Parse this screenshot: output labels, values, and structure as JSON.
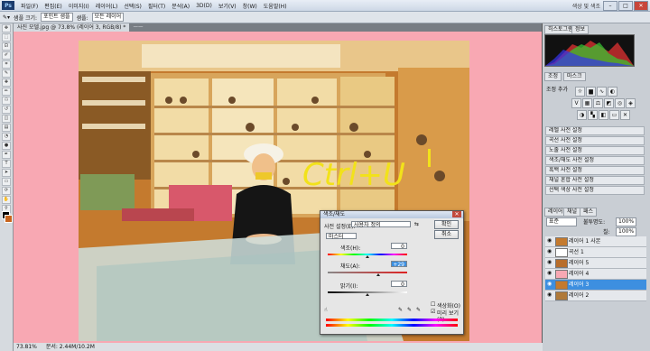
{
  "menubar": {
    "logo": "Ps",
    "items": [
      "파일(F)",
      "편집(E)",
      "이미지(I)",
      "레이어(L)",
      "선택(S)",
      "필터(T)",
      "분석(A)",
      "3D(D)",
      "보기(V)",
      "창(W)",
      "도움말(H)"
    ],
    "workspace": "색상 및 색조",
    "win_ctrls": [
      "–",
      "□",
      "✕"
    ]
  },
  "options": {
    "size_label": "샘플 크기:",
    "size_value": "포인트 샘플",
    "sample_label": "샘플:",
    "sample_value": "모든 레이어"
  },
  "document": {
    "tab": "사진 모델.jpg @ 73.8% (레이어 3, RGB/8) *",
    "tab2": "ㅡㅡ"
  },
  "status": {
    "zoom": "73.81%",
    "doc": "문서: 2.44M/10.2M"
  },
  "photo_annotation": "Ctrl+U",
  "panels": {
    "histogram_tabs": [
      "히스토그램",
      "정보"
    ],
    "adjust_tabs": [
      "조정",
      "마스크"
    ],
    "adjust_title": "조정 추가",
    "presets": [
      "레벨 사전 설정",
      "곡선 사전 설정",
      "노출 사전 설정",
      "색조/채도 사전 설정",
      "흑백 사전 설정",
      "채널 혼합 사전 설정",
      "선택 색상 사전 설정"
    ],
    "layer_tabs": [
      "레이어",
      "채널",
      "패스"
    ],
    "blend_mode": "표준",
    "opacity_label": "불투명도:",
    "opacity": "100%",
    "fill_label": "칠:",
    "fill": "100%",
    "layers": [
      {
        "name": "레이어 1 사본",
        "selected": false
      },
      {
        "name": "곡선 1",
        "selected": false
      },
      {
        "name": "레이어 5",
        "selected": false
      },
      {
        "name": "레이어 4",
        "selected": false
      },
      {
        "name": "레이어 3",
        "selected": true
      },
      {
        "name": "레이어 2",
        "selected": false
      }
    ]
  },
  "dialog": {
    "title": "색조/채도",
    "preset_label": "사전 설정(E):",
    "preset_value": "사용자 정의",
    "channel": "마스터",
    "hue_label": "색조(H):",
    "hue": "0",
    "hue_pos": 0.5,
    "saturation_label": "채도(A):",
    "saturation": "+29",
    "saturation_pos": 0.64,
    "lightness_label": "밝기(I):",
    "lightness": "0",
    "lightness_pos": 0.5,
    "ok": "확인",
    "cancel": "취소",
    "colorize": "색상화(O)",
    "preview": "미리 보기(P)"
  },
  "colors": {
    "canvas": "#f8a8b3",
    "selection": "#3d8fe0",
    "annotation": "#f2e21a"
  }
}
